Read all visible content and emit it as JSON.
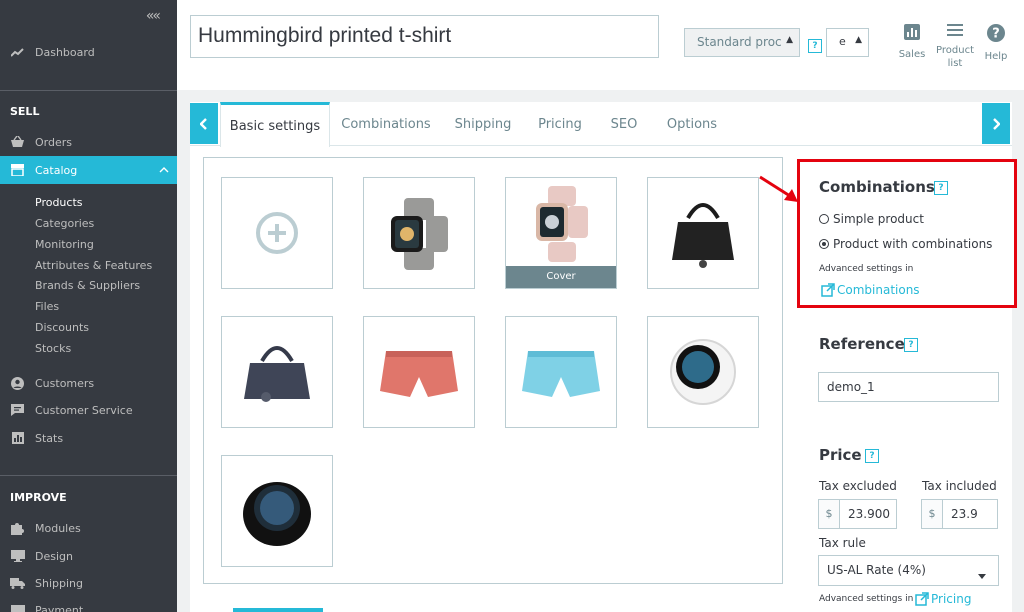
{
  "sidebar": {
    "collapse": "«",
    "dashboard": "Dashboard",
    "sell_title": "SELL",
    "orders": "Orders",
    "catalog": "Catalog",
    "catalog_sub": [
      "Products",
      "Categories",
      "Monitoring",
      "Attributes & Features",
      "Brands & Suppliers",
      "Files",
      "Discounts",
      "Stocks"
    ],
    "customers": "Customers",
    "customer_service": "Customer Service",
    "stats": "Stats",
    "improve_title": "IMPROVE",
    "modules": "Modules",
    "design": "Design",
    "shipping": "Shipping",
    "payment": "Payment"
  },
  "header": {
    "product_name": "Hummingbird printed t-shirt",
    "product_type": "Standard proc",
    "lang": "e",
    "tools": {
      "sales": "Sales",
      "product_list_1": "Product",
      "product_list_2": "list",
      "help": "Help"
    }
  },
  "tabs": [
    "Basic settings",
    "Combinations",
    "Shipping",
    "Pricing",
    "SEO",
    "Options"
  ],
  "images": {
    "cover_label": "Cover"
  },
  "combinations": {
    "title": "Combinations",
    "simple": "Simple product",
    "with_combinations": "Product with combinations",
    "advanced": "Advanced settings in",
    "link": "Combinations"
  },
  "reference": {
    "title": "Reference",
    "value": "demo_1"
  },
  "price": {
    "title": "Price",
    "tax_excluded_label": "Tax excluded",
    "tax_included_label": "Tax included",
    "currency": "$",
    "tax_excluded_value": "23.900",
    "tax_included_value": "23.9",
    "tax_rule_label": "Tax rule",
    "tax_rule_value": "US-AL Rate (4%)",
    "advanced": "Advanced settings in",
    "pricing_link": "Pricing"
  },
  "help_glyph": "?",
  "colors": {
    "accent": "#25b9d7",
    "sidebar": "#363a41",
    "highlight": "#e4030f"
  }
}
